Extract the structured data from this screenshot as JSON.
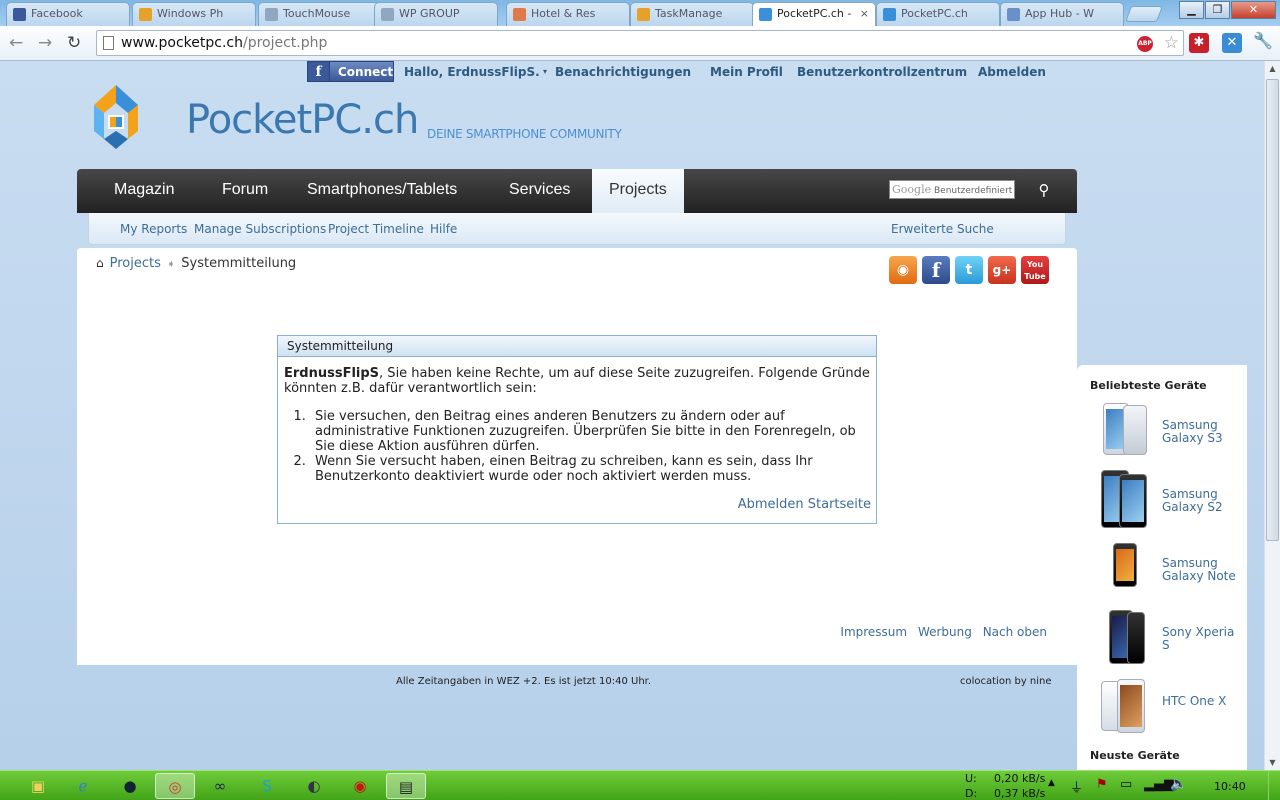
{
  "browser": {
    "tabs": [
      {
        "label": "Facebook"
      },
      {
        "label": "Windows Ph"
      },
      {
        "label": "TouchMouse"
      },
      {
        "label": "WP GROUP"
      },
      {
        "label": "Hotel & Res"
      },
      {
        "label": "TaskManage"
      },
      {
        "label": "PocketPC.ch -"
      },
      {
        "label": "PocketPC.ch"
      },
      {
        "label": "App Hub - W"
      }
    ],
    "url_domain": "www.pocketpc.ch",
    "url_path": "/project.php"
  },
  "userbar": {
    "connect_label": "Connect",
    "greeting": "Hallo, ErdnussFlipS.",
    "notifications": "Benachrichtigungen",
    "profile": "Mein Profil",
    "control_center": "Benutzerkontrollzentrum",
    "logout": "Abmelden"
  },
  "logo": {
    "name": "PocketPC.ch",
    "tagline": "DEINE SMARTPHONE COMMUNITY"
  },
  "nav": {
    "items": [
      "Magazin",
      "Forum",
      "Smartphones/Tablets",
      "Services",
      "Projects"
    ],
    "search_google": "Google",
    "search_placeholder": "Benutzerdefiniert"
  },
  "subnav": {
    "items": [
      "My Reports",
      "Manage Subscriptions",
      "Project Timeline",
      "Hilfe"
    ],
    "advanced_search": "Erweiterte Suche"
  },
  "breadcrumb": {
    "link": "Projects",
    "current": "Systemmitteilung"
  },
  "message": {
    "title": "Systemmitteilung",
    "username": "ErdnussFlipS",
    "intro": ", Sie haben keine Rechte, um auf diese Seite zuzugreifen. Folgende Gründe könnten z.B. dafür verantwortlich sein:",
    "reasons": [
      "Sie versuchen, den Beitrag eines anderen Benutzers zu ändern oder auf administrative Funktionen zuzugreifen. Überprüfen Sie bitte in den Forenregeln, ob Sie diese Aktion ausführen dürfen.",
      "Wenn Sie versucht haben, einen Beitrag zu schreiben, kann es sein, dass Ihr Benutzerkonto deaktiviert wurde oder noch aktiviert werden muss."
    ],
    "logout": "Abmelden",
    "home": "Startseite"
  },
  "footer": {
    "links": [
      "Impressum",
      "Werbung",
      "Nach oben"
    ],
    "timezone": "Alle Zeitangaben in WEZ +2. Es ist jetzt 10:40 Uhr.",
    "colocation": "colocation by nine"
  },
  "sidebar": {
    "popular_title": "Beliebteste Geräte",
    "devices": [
      "Samsung Galaxy S3",
      "Samsung Galaxy S2",
      "Samsung Galaxy Note",
      "Sony Xperia S",
      "HTC One X"
    ],
    "newest_title": "Neuste Geräte"
  },
  "taskbar": {
    "net_up_label": "U:",
    "net_up": "0,20 kB/s",
    "net_down_label": "D:",
    "net_down": "0,37 kB/s",
    "clock": "10:40"
  },
  "colors": {
    "link": "#3e6d98",
    "nav_bg": "#2b2b2b",
    "page_bg": "#c5daee",
    "taskbar": "#55b92a"
  }
}
